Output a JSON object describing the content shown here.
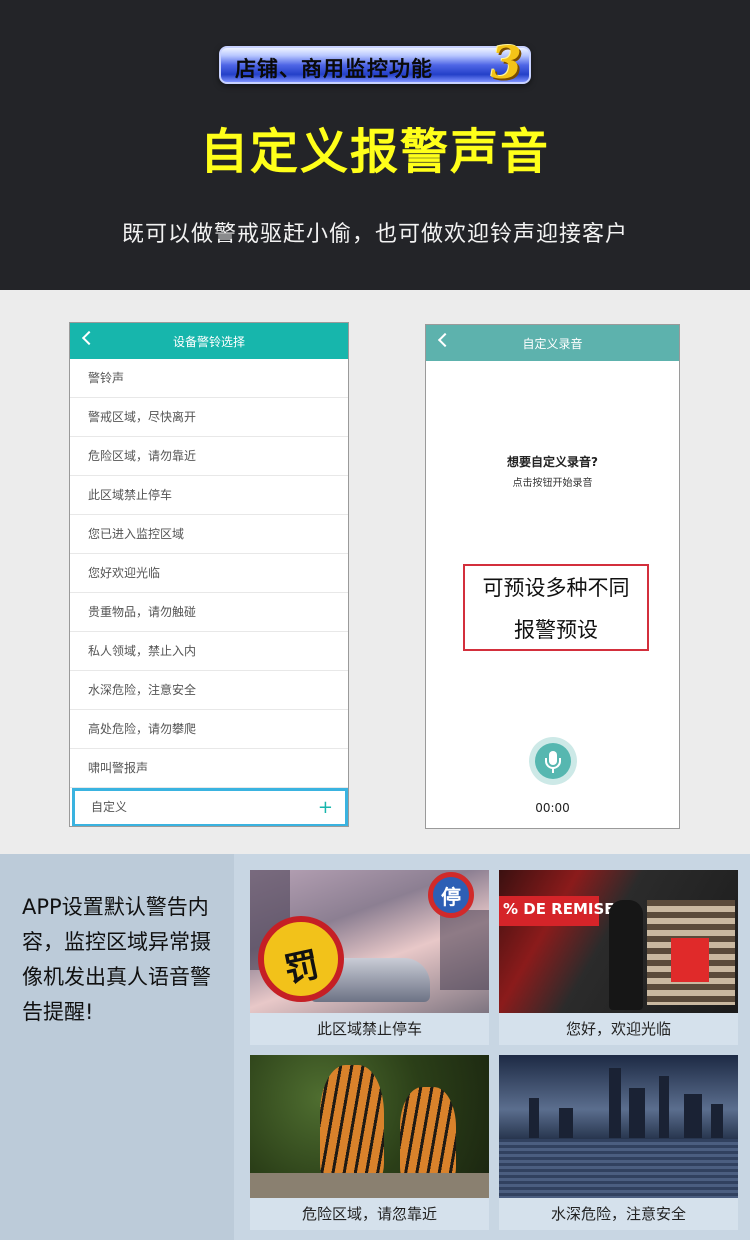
{
  "hero": {
    "badge_text": "店铺、商用监控功能",
    "badge_number": "3",
    "title": "自定义报警声音",
    "subtitle": "既可以做警戒驱赶小偷，也可做欢迎铃声迎接客户"
  },
  "alarm_select": {
    "title": "设备警铃选择",
    "items": [
      "警铃声",
      "警戒区域，尽快离开",
      "危险区域，请勿靠近",
      "此区域禁止停车",
      "您已进入监控区域",
      "您好欢迎光临",
      "贵重物品，请勿触碰",
      "私人领域，禁止入内",
      "水深危险，注意安全",
      "高处危险，请勿攀爬",
      "啸叫警报声"
    ],
    "custom_label": "自定义",
    "add_symbol": "+"
  },
  "recorder": {
    "title": "自定义录音",
    "prompt_title": "想要自定义录音?",
    "prompt_sub": "点击按钮开始录音",
    "callout_line1": "可预设多种不同",
    "callout_line2": "报警预设",
    "timer": "00:00"
  },
  "bottom": {
    "description": "APP设置默认警告内容，监控区域异常摄像机发出真人语音警告提醒!",
    "tiles": [
      {
        "caption": "此区域禁止停车",
        "fine_glyph": "罚",
        "sign_glyph": "停"
      },
      {
        "caption": "您好，欢迎光临",
        "store_banner": "% DE REMISE"
      },
      {
        "caption": "危险区域，请忽靠近"
      },
      {
        "caption": "水深危险，注意安全"
      }
    ]
  },
  "colors": {
    "hero_bg": "#232428",
    "title_yellow": "#ffff1a",
    "teal_bar": "#17b6ac",
    "callout_red": "#d32f3c",
    "custom_border": "#3ab3e0"
  }
}
